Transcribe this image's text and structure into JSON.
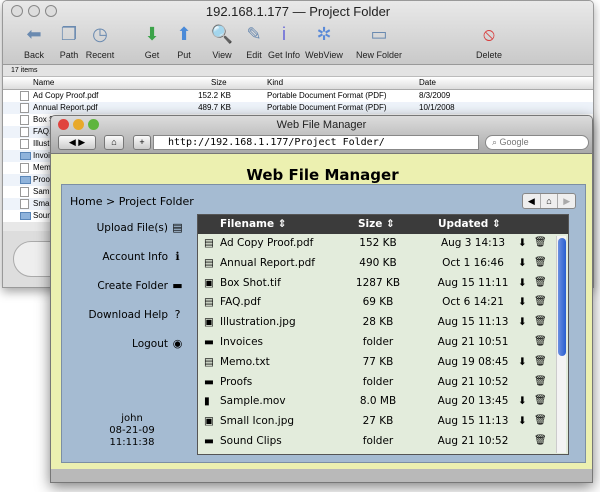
{
  "back_window": {
    "title": "192.168.1.177 — Project Folder",
    "toolbar": [
      {
        "label": "Back",
        "icon": "back-arrow-icon"
      },
      {
        "label": "Path",
        "icon": "path-icon"
      },
      {
        "label": "Recent",
        "icon": "recent-icon"
      },
      {
        "label": "Get",
        "icon": "download-icon"
      },
      {
        "label": "Put",
        "icon": "upload-icon"
      },
      {
        "label": "View",
        "icon": "view-icon"
      },
      {
        "label": "Edit",
        "icon": "edit-icon"
      },
      {
        "label": "Get Info",
        "icon": "info-icon"
      },
      {
        "label": "WebView",
        "icon": "compass-icon"
      },
      {
        "label": "New Folder",
        "icon": "new-folder-icon"
      },
      {
        "label": "Delete",
        "icon": "delete-icon"
      }
    ],
    "status": "17 items",
    "columns": {
      "name": "Name",
      "size": "Size",
      "kind": "Kind",
      "date": "Date"
    },
    "rows": [
      {
        "name": "Ad Copy Proof.pdf",
        "size": "152.2 KB",
        "kind": "Portable Document Format (PDF)",
        "date": "8/3/2009",
        "folder": false
      },
      {
        "name": "Annual Report.pdf",
        "size": "489.7 KB",
        "kind": "Portable Document Format (PDF)",
        "date": "10/1/2008",
        "folder": false
      },
      {
        "name": "Box S",
        "folder": false
      },
      {
        "name": "FAQ.",
        "folder": false
      },
      {
        "name": "Illust",
        "folder": false
      },
      {
        "name": "Invoi",
        "folder": true
      },
      {
        "name": "Memo",
        "folder": false
      },
      {
        "name": "Proof",
        "folder": true
      },
      {
        "name": "Samp",
        "folder": false
      },
      {
        "name": "Small",
        "folder": false
      },
      {
        "name": "Soun",
        "folder": true
      }
    ]
  },
  "browser": {
    "title": "Web File Manager",
    "url": "http://192.168.1.177/Project Folder/",
    "search_placeholder": "Google"
  },
  "app": {
    "title": "Web File Manager",
    "breadcrumb": "Home > Project Folder",
    "sidebar": [
      {
        "label": "Upload File(s)",
        "icon": "▤"
      },
      {
        "label": "Account Info",
        "icon": "ℹ"
      },
      {
        "label": "Create Folder",
        "icon": "▬"
      },
      {
        "label": "Download Help",
        "icon": "?"
      },
      {
        "label": "Logout",
        "icon": "◉"
      }
    ],
    "user": {
      "name": "john",
      "date": "08-21-09",
      "time": "11:11:38"
    },
    "columns": {
      "filename": "Filename ⇕",
      "size": "Size ⇕",
      "updated": "Updated ⇕"
    },
    "files": [
      {
        "name": "Ad Copy Proof.pdf",
        "size": "152 KB",
        "updated": "Aug 3 14:13",
        "type": "doc"
      },
      {
        "name": "Annual Report.pdf",
        "size": "490 KB",
        "updated": "Oct 1 16:46",
        "type": "doc"
      },
      {
        "name": "Box Shot.tif",
        "size": "1287 KB",
        "updated": "Aug 15 11:11",
        "type": "image"
      },
      {
        "name": "FAQ.pdf",
        "size": "69 KB",
        "updated": "Oct 6 14:21",
        "type": "doc"
      },
      {
        "name": "Illustration.jpg",
        "size": "28 KB",
        "updated": "Aug 15 11:13",
        "type": "image"
      },
      {
        "name": "Invoices",
        "size": "folder",
        "updated": "Aug 21 10:51",
        "type": "folder"
      },
      {
        "name": "Memo.txt",
        "size": "77 KB",
        "updated": "Aug 19 08:45",
        "type": "doc"
      },
      {
        "name": "Proofs",
        "size": "folder",
        "updated": "Aug 21 10:52",
        "type": "folder"
      },
      {
        "name": "Sample.mov",
        "size": "8.0 MB",
        "updated": "Aug 20 13:45",
        "type": "movie"
      },
      {
        "name": "Small Icon.jpg",
        "size": "27 KB",
        "updated": "Aug 15 11:13",
        "type": "image"
      },
      {
        "name": "Sound Clips",
        "size": "folder",
        "updated": "Aug 21 10:52",
        "type": "folder"
      }
    ]
  }
}
